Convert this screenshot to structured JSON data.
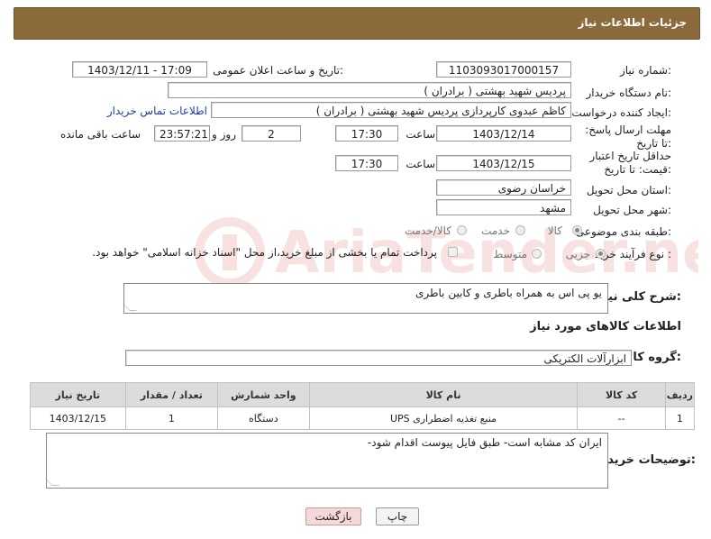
{
  "header": {
    "title": "جزئیات اطلاعات نیاز"
  },
  "form": {
    "need_number_label": "شماره نیاز:",
    "need_number": "1103093017000157",
    "announce_label": "تاریخ و ساعت اعلان عمومی:",
    "announce_value": "1403/12/11 - 17:09",
    "buyer_org_label": "نام دستگاه خریدار:",
    "buyer_org": "پردیس شهید بهشتی ( برادران )",
    "creator_label": "ایجاد کننده درخواست:",
    "creator": "کاظم  عبدوی  کارپردازی  پردیس شهید بهشتی ( برادران )",
    "contact_link": "اطلاعات تماس خریدار",
    "deadline_label": "مهلت ارسال پاسخ: تا تاریخ:",
    "deadline_date": "1403/12/14",
    "time_label": "ساعت",
    "deadline_time": "17:30",
    "days_value": "2",
    "days_label": "روز و",
    "remaining_time": "23:57:21",
    "remaining_label": "ساعت باقی مانده",
    "validity_label": "حداقل تاریخ اعتبار قیمت: تا تاریخ:",
    "validity_date": "1403/12/15",
    "validity_time": "17:30",
    "province_label": "استان محل تحویل:",
    "province": "خراسان رضوی",
    "city_label": "شهر محل تحویل:",
    "city": "مشهد",
    "category_label": "طبقه بندی موضوعی:",
    "category_options": [
      "کالا",
      "خدمت",
      "کالا/خدمت"
    ],
    "purchase_label": "نوع فرآیند خرید :",
    "purchase_options": [
      "جزیی",
      "متوسط"
    ],
    "payment_note": "پرداخت تمام یا بخشی از مبلغ خرید،از محل \"اسناد خزانه اسلامی\" خواهد بود."
  },
  "summary": {
    "label": "شرح کلی نیاز:",
    "value": "یو پی اس به همراه باطری و کابین باطری"
  },
  "goods_section_title": "اطلاعات کالاهای مورد نیاز",
  "goods_group": {
    "label": "گروه کالا:",
    "value": "ابزارآلات الکتریکی"
  },
  "table": {
    "headers": [
      "ردیف",
      "کد کالا",
      "نام کالا",
      "واحد شمارش",
      "تعداد / مقدار",
      "تاریخ نیاز"
    ],
    "rows": [
      [
        "1",
        "--",
        "منبع تغذیه اضطراری UPS",
        "دستگاه",
        "1",
        "1403/12/15"
      ]
    ]
  },
  "buyer_notes": {
    "label": "توضیحات خریدار:",
    "value": "ایران کد مشابه است- طبق فایل پیوست اقدام شود-"
  },
  "buttons": {
    "print": "چاپ",
    "back": "بازگشت"
  },
  "watermark_text": "AriaTender.net",
  "colors": {
    "header": "#8b6b3c",
    "link": "#1a3fb0",
    "back_button": "#f5d9d9"
  }
}
